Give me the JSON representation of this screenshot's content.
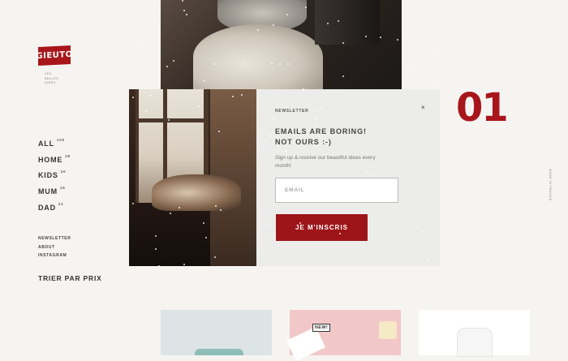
{
  "brand": {
    "logo_text": "GIEUTO",
    "tagline_lines": [
      "LES",
      "BELLES",
      "IDEES"
    ]
  },
  "nav": {
    "main": [
      {
        "label": "ALL",
        "count": "100"
      },
      {
        "label": "HOME",
        "count": "28"
      },
      {
        "label": "KIDS",
        "count": "20"
      },
      {
        "label": "MUM",
        "count": "16"
      },
      {
        "label": "DAD",
        "count": "21"
      }
    ],
    "secondary": [
      "NEWSLETTER",
      "ABOUT",
      "INSTAGRAM"
    ],
    "sort_label": "TRIER PAR PRIX"
  },
  "slide_counter": "01",
  "vertical_text": "MADE IN FRANCE",
  "modal": {
    "label": "NEWSLETTER",
    "close_symbol": "×",
    "headline": "EMAILS ARE BORING!\nNOT OURS :-)",
    "description": "Sign up & receive our beautiful ideas every month!",
    "email_placeholder": "EMAIL",
    "submit_label": "JE M'INSCRIS"
  },
  "products": [
    {
      "badge": ""
    },
    {
      "badge": "NEW!"
    },
    {
      "badge": ""
    }
  ],
  "colors": {
    "accent": "#a8161b",
    "background": "#f5f4f1"
  }
}
